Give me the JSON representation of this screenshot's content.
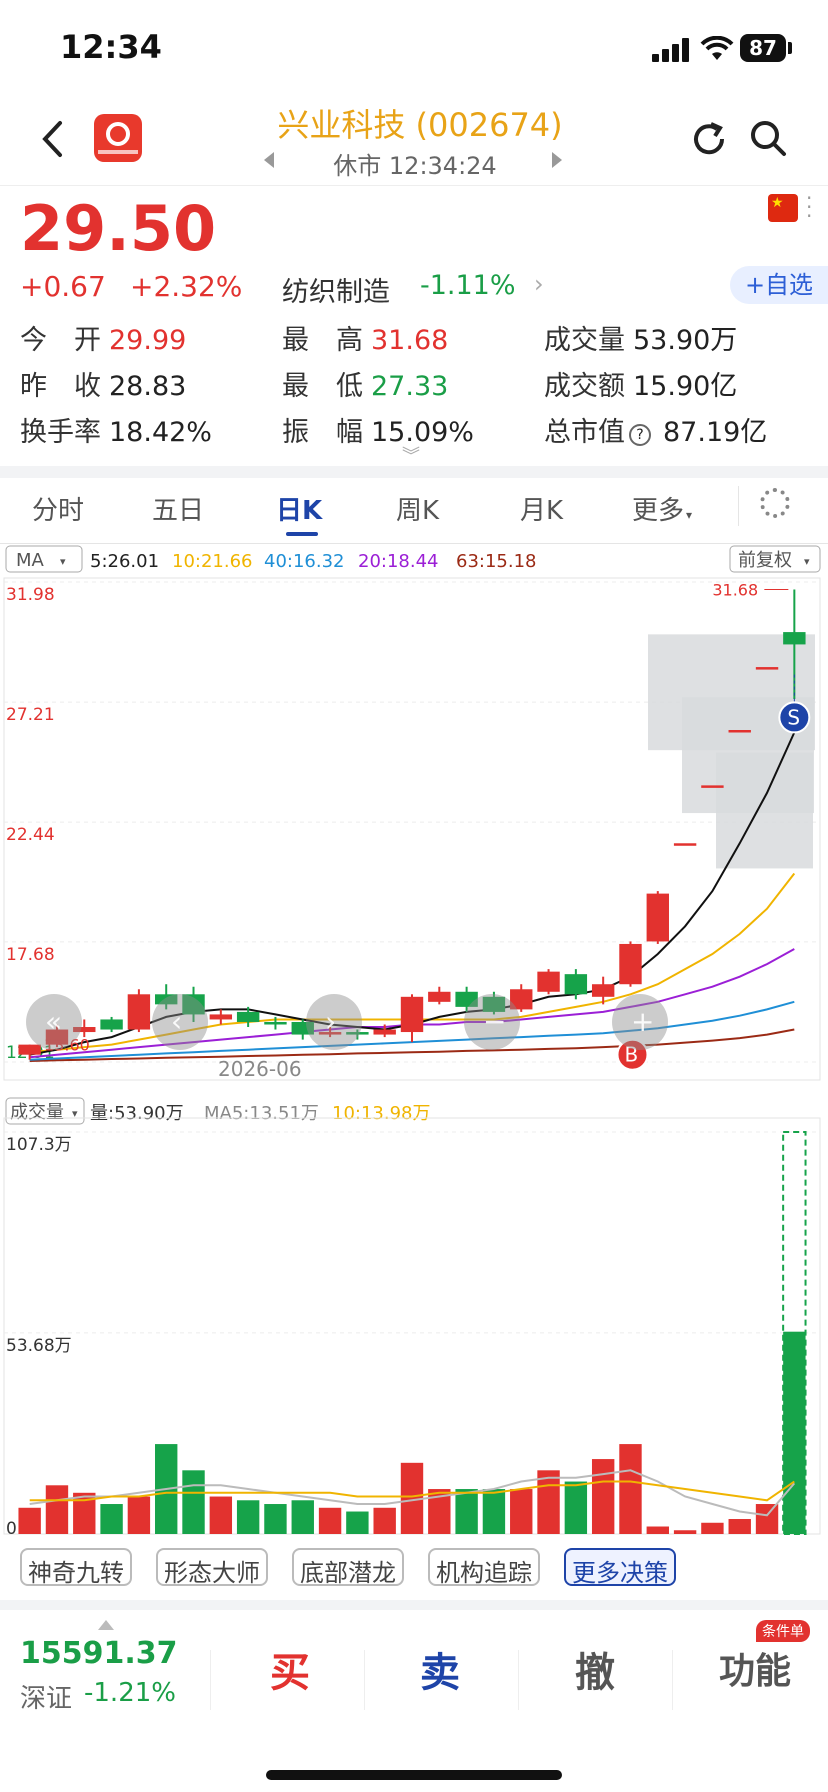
{
  "status": {
    "time": "12:34",
    "battery": "87"
  },
  "header": {
    "title": "兴业科技 (002674)",
    "subtitle": "休市 12:34:24"
  },
  "quote": {
    "price": "29.50",
    "change": "+0.67",
    "change_pct": "+2.32%",
    "sector_name": "纺织制造",
    "sector_change": "-1.11%",
    "add_watch": "+自选",
    "stats": [
      {
        "label": "今　开",
        "value": "29.99",
        "color": "red"
      },
      {
        "label": "最　高",
        "value": "31.68",
        "color": "red"
      },
      {
        "label": "成交量",
        "value": "53.90万",
        "color": "dark"
      },
      {
        "label": "昨　收",
        "value": "28.83",
        "color": "dark"
      },
      {
        "label": "最　低",
        "value": "27.33",
        "color": "green"
      },
      {
        "label": "成交额",
        "value": "15.90亿",
        "color": "dark"
      },
      {
        "label": "换手率",
        "value": "18.42%",
        "color": "dark"
      },
      {
        "label": "振　幅",
        "value": "15.09%",
        "color": "dark"
      },
      {
        "label": "总市值",
        "value": "87.19亿",
        "color": "dark"
      }
    ]
  },
  "tabs": [
    "分时",
    "五日",
    "日K",
    "周K",
    "月K",
    "更多"
  ],
  "ma_bar": {
    "selector": "MA",
    "ma5": "5:26.01",
    "ma10": "10:21.66",
    "ma40": "40:16.32",
    "ma20": "20:18.44",
    "ma63": "63:15.18",
    "adjust": "前复权"
  },
  "colors": {
    "up": "#e2322f",
    "down": "#16a34a",
    "ma5": "#111111",
    "ma10": "#f0b400",
    "ma20": "#9b1fd6",
    "ma40": "#1f8fd6",
    "ma63": "#9b2a15",
    "accent": "#1e44a8"
  },
  "chart_data": [
    {
      "type": "candlestick",
      "y_ticks": [
        "31.98",
        "27.21",
        "22.44",
        "17.68",
        "12.91"
      ],
      "ylim": [
        12.91,
        31.98
      ],
      "x_label": "2026-06",
      "high_marker": "31.68",
      "low_marker": "13.60",
      "candles": [
        [
          13.2,
          13.6,
          13.6,
          13.0
        ],
        [
          13.6,
          14.2,
          14.4,
          13.5
        ],
        [
          14.1,
          14.3,
          14.6,
          13.9
        ],
        [
          14.6,
          14.2,
          14.7,
          14.1
        ],
        [
          14.2,
          15.6,
          15.8,
          14.1
        ],
        [
          15.6,
          15.2,
          16.0,
          15.0
        ],
        [
          15.6,
          14.8,
          15.9,
          14.5
        ],
        [
          14.6,
          14.8,
          15.0,
          14.4
        ],
        [
          14.9,
          14.5,
          15.1,
          14.3
        ],
        [
          14.5,
          14.4,
          14.7,
          14.2
        ],
        [
          14.5,
          14.0,
          14.6,
          13.8
        ],
        [
          14.0,
          14.1,
          14.3,
          13.9
        ],
        [
          14.1,
          14.0,
          14.2,
          13.8
        ],
        [
          14.0,
          14.2,
          14.4,
          13.9
        ],
        [
          14.1,
          15.5,
          15.6,
          13.7
        ],
        [
          15.3,
          15.7,
          15.9,
          15.2
        ],
        [
          15.7,
          15.1,
          15.9,
          14.9
        ],
        [
          15.5,
          14.9,
          15.7,
          14.8
        ],
        [
          15.0,
          15.8,
          16.0,
          14.9
        ],
        [
          15.7,
          16.5,
          16.6,
          15.6
        ],
        [
          16.4,
          15.6,
          16.6,
          15.4
        ],
        [
          15.5,
          16.0,
          16.3,
          15.2
        ],
        [
          16.0,
          17.6,
          17.7,
          15.9
        ],
        [
          17.7,
          19.6,
          19.7,
          17.6
        ],
        [
          21.6,
          21.6,
          21.6,
          21.6
        ],
        [
          23.9,
          23.9,
          23.9,
          23.9
        ],
        [
          26.1,
          26.1,
          26.1,
          26.1
        ],
        [
          28.6,
          28.6,
          28.6,
          28.6
        ],
        [
          29.99,
          29.5,
          31.68,
          27.33
        ]
      ],
      "ma5": [
        13.2,
        13.4,
        13.7,
        13.9,
        14.3,
        14.7,
        14.9,
        15.0,
        15.0,
        14.8,
        14.6,
        14.4,
        14.3,
        14.2,
        14.4,
        14.7,
        14.9,
        15.0,
        15.2,
        15.5,
        15.6,
        15.8,
        16.3,
        17.2,
        18.3,
        19.7,
        21.6,
        23.6,
        26.0
      ],
      "ma10": [
        13.3,
        13.4,
        13.5,
        13.6,
        13.8,
        14.0,
        14.2,
        14.4,
        14.5,
        14.6,
        14.6,
        14.6,
        14.6,
        14.6,
        14.6,
        14.6,
        14.6,
        14.6,
        14.7,
        14.9,
        15.1,
        15.3,
        15.6,
        16.0,
        16.6,
        17.2,
        18.0,
        19.0,
        20.4
      ],
      "ma20": [
        13.1,
        13.2,
        13.3,
        13.4,
        13.5,
        13.6,
        13.7,
        13.8,
        13.9,
        14.0,
        14.1,
        14.2,
        14.3,
        14.3,
        14.4,
        14.4,
        14.5,
        14.5,
        14.6,
        14.7,
        14.8,
        14.9,
        15.1,
        15.3,
        15.6,
        15.9,
        16.3,
        16.8,
        17.4
      ],
      "ma40": [
        13.0,
        13.05,
        13.1,
        13.15,
        13.2,
        13.25,
        13.3,
        13.35,
        13.4,
        13.45,
        13.5,
        13.55,
        13.6,
        13.65,
        13.7,
        13.75,
        13.8,
        13.85,
        13.9,
        13.95,
        14.0,
        14.05,
        14.15,
        14.25,
        14.4,
        14.55,
        14.75,
        15.0,
        15.3
      ],
      "ma63": [
        12.95,
        12.98,
        13.0,
        13.03,
        13.05,
        13.08,
        13.1,
        13.12,
        13.15,
        13.17,
        13.2,
        13.22,
        13.25,
        13.27,
        13.3,
        13.32,
        13.35,
        13.37,
        13.4,
        13.43,
        13.46,
        13.5,
        13.55,
        13.6,
        13.68,
        13.76,
        13.86,
        14.0,
        14.2
      ]
    },
    {
      "type": "bar",
      "selector": "成交量",
      "vol_label": "量:53.90万",
      "ma5_label": "MA5:13.51万",
      "ma10_label": "10:13.98万",
      "y_ticks": [
        "107.3万",
        "53.68万",
        "0"
      ],
      "ylim": [
        0,
        107.3
      ],
      "values": [
        7,
        13,
        11,
        8,
        10,
        24,
        17,
        10,
        9,
        8,
        9,
        7,
        6,
        7,
        19,
        12,
        12,
        12,
        12,
        17,
        14,
        20,
        24,
        2,
        1,
        3,
        4,
        8,
        54
      ],
      "vol_ma5": [
        8,
        9,
        10,
        10,
        11,
        12,
        13,
        13,
        12,
        11,
        10,
        9,
        8,
        8,
        9,
        10,
        11,
        12,
        14,
        15,
        15,
        16,
        17,
        14,
        10,
        8,
        6,
        5,
        13.51
      ],
      "vol_ma10": [
        9,
        9,
        9,
        10,
        10,
        11,
        11,
        11,
        11,
        11,
        11,
        11,
        10,
        10,
        10,
        11,
        11,
        11,
        12,
        13,
        13,
        14,
        14,
        13,
        12,
        11,
        10,
        9,
        13.98
      ]
    }
  ],
  "chart_controls": {
    "s_marker": "S",
    "b_marker": "B"
  },
  "tools": [
    "神奇九转",
    "形态大师",
    "底部潜龙",
    "机构追踪",
    "更多决策"
  ],
  "bottom": {
    "index_value": "15591.37",
    "index_name": "深证",
    "index_change": "-1.21%",
    "buy": "买",
    "sell": "卖",
    "cancel": "撤",
    "func": "功能",
    "func_badge": "条件单"
  }
}
